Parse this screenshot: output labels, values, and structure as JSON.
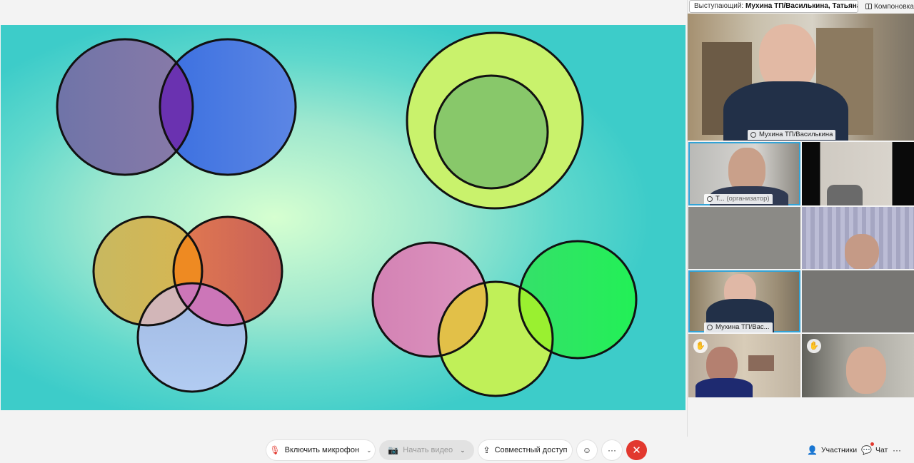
{
  "speaker": {
    "prefix": "Выступающий:",
    "name": "Мухина ТП/Василькина, Татьяна Ан..."
  },
  "layout_button": "Компоновка",
  "tiles": [
    {
      "id": "main",
      "label": "Мухина ТП/Василькина",
      "suffix": ""
    },
    {
      "id": "host",
      "label": "Т...",
      "suffix": "(организатор)"
    },
    {
      "id": "self",
      "label": "Мухина ТП/Вас...",
      "suffix": ""
    }
  ],
  "slide": {
    "background_center": "#d6ffd0",
    "background_edge": "#3dccc9",
    "circle_colors": {
      "venn2_left": "#7a76a8",
      "venn2_right": "#4878e0",
      "venn2_overlap": "#6a3aa8",
      "outer_ring": "#cdf46e",
      "inner_circle": "#86c86a",
      "venn3_left": "#cfb85a",
      "venn3_right": "#d86a56",
      "venn3_bottom": "#a8c4ec",
      "chain_left": "#d98ab8",
      "chain_middle": "#c2f25a",
      "chain_right": "#2aee5c"
    }
  },
  "toolbar": {
    "mic": "Включить микрофон",
    "video": "Начать видео",
    "share": "Совместный доступ",
    "participants": "Участники",
    "chat": "Чат",
    "more": "···"
  },
  "icons": [
    "mic-off-icon",
    "video-icon",
    "share-icon",
    "emoji-icon",
    "more-icon",
    "end-call-icon",
    "participants-icon",
    "chat-icon",
    "layout-icon",
    "raise-hand-icon"
  ],
  "colors": {
    "accent": "#32a3d6",
    "end_call": "#e2382e"
  }
}
